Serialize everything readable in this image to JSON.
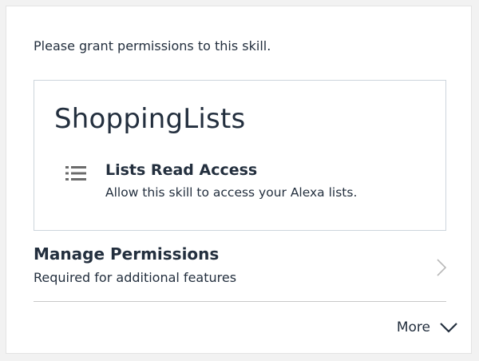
{
  "prompt_text": "Please grant permissions to this skill.",
  "skill": {
    "name": "ShoppingLists",
    "permission": {
      "icon": "list-icon",
      "title": "Lists Read Access",
      "description": "Allow this skill to access your Alexa lists."
    }
  },
  "manage": {
    "title": "Manage Permissions",
    "subtitle": "Required for additional features",
    "icon": "chevron-right-icon"
  },
  "more": {
    "label": "More",
    "icon": "chevron-down-icon"
  },
  "colors": {
    "text": "#232f3e",
    "icon_gray": "#6b6b6b",
    "border": "#cdd5dc",
    "page_bg": "#f2f2f2"
  }
}
